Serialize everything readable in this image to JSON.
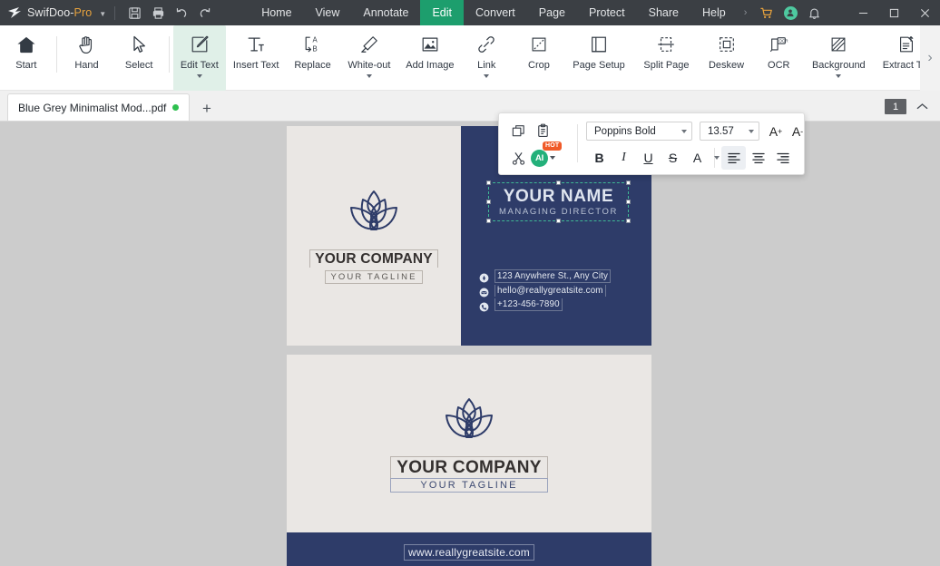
{
  "app": {
    "brand_name": "SwifDoo-",
    "brand_suffix": "Pro",
    "quick_actions": [
      {
        "name": "save-icon",
        "label": "Save"
      },
      {
        "name": "print-icon",
        "label": "Print"
      },
      {
        "name": "undo-icon",
        "label": "Undo"
      },
      {
        "name": "redo-icon",
        "label": "Redo"
      }
    ],
    "menu": [
      {
        "label": "Home",
        "active": false
      },
      {
        "label": "View",
        "active": false
      },
      {
        "label": "Annotate",
        "active": false
      },
      {
        "label": "Edit",
        "active": true
      },
      {
        "label": "Convert",
        "active": false
      },
      {
        "label": "Page",
        "active": false
      },
      {
        "label": "Protect",
        "active": false
      },
      {
        "label": "Share",
        "active": false
      },
      {
        "label": "Help",
        "active": false
      }
    ],
    "menu_overflow": "›",
    "right_icons": [
      {
        "name": "cart-icon",
        "label": "Shop"
      },
      {
        "name": "user-avatar-icon",
        "label": "Account"
      },
      {
        "name": "bell-icon",
        "label": "Notifications"
      }
    ],
    "window_controls": [
      {
        "name": "minimize-button",
        "label": "—"
      },
      {
        "name": "maximize-button",
        "label": "□"
      },
      {
        "name": "close-button",
        "label": "✕"
      }
    ]
  },
  "ribbon": {
    "items": [
      {
        "label": "Start",
        "icon": "home-icon",
        "dropdown": false,
        "active": false
      },
      {
        "label": "Hand",
        "icon": "hand-icon",
        "dropdown": false,
        "active": false
      },
      {
        "label": "Select",
        "icon": "cursor-icon",
        "dropdown": false,
        "active": false
      },
      {
        "label": "Edit Text",
        "icon": "edit-text-icon",
        "dropdown": true,
        "active": true
      },
      {
        "label": "Insert Text",
        "icon": "insert-text-icon",
        "dropdown": false,
        "active": false
      },
      {
        "label": "Replace",
        "icon": "replace-icon",
        "dropdown": false,
        "active": false
      },
      {
        "label": "White-out",
        "icon": "whiteout-icon",
        "dropdown": true,
        "active": false
      },
      {
        "label": "Add Image",
        "icon": "add-image-icon",
        "dropdown": false,
        "active": false
      },
      {
        "label": "Link",
        "icon": "link-icon",
        "dropdown": true,
        "active": false
      },
      {
        "label": "Crop",
        "icon": "crop-icon",
        "dropdown": false,
        "active": false
      },
      {
        "label": "Page Setup",
        "icon": "page-setup-icon",
        "dropdown": false,
        "active": false
      },
      {
        "label": "Split Page",
        "icon": "split-page-icon",
        "dropdown": false,
        "active": false
      },
      {
        "label": "Deskew",
        "icon": "deskew-icon",
        "dropdown": false,
        "active": false
      },
      {
        "label": "OCR",
        "icon": "ocr-icon",
        "dropdown": false,
        "active": false
      },
      {
        "label": "Background",
        "icon": "background-icon",
        "dropdown": true,
        "active": false
      },
      {
        "label": "Extract TO",
        "icon": "extract-icon",
        "dropdown": false,
        "active": false
      }
    ],
    "overflow_label": "›"
  },
  "tabstrip": {
    "document_tab": "Blue Grey Minimalist Mod...pdf",
    "unsaved": true,
    "new_tab_label": "+",
    "page_number": "1",
    "collapse_label": "⌃"
  },
  "text_toolbar": {
    "copy_label": "Copy",
    "paste_label": "Paste",
    "cut_label": "Cut",
    "ai_label": "AI",
    "ai_badge": "HOT",
    "font_family": "Poppins Bold",
    "font_size": "13.57",
    "increase_size": "A",
    "increase_sup": "+",
    "decrease_size": "A",
    "decrease_sup": "-",
    "bold": "B",
    "italic": "I",
    "underline": "U",
    "strikethrough": "S",
    "font_color": "A",
    "align_left": "align-left",
    "align_center": "align-center",
    "align_right": "align-right",
    "active_alignment": "align-left"
  },
  "document": {
    "card_front": {
      "company_name": "YOUR COMPANY",
      "tagline": "YOUR TAGLINE",
      "person_name": "YOUR NAME",
      "person_role": "MANAGING DIRECTOR",
      "contact": [
        {
          "icon": "location-pin-icon",
          "text": "123 Anywhere St., Any City"
        },
        {
          "icon": "envelope-icon",
          "text": "hello@reallygreatsite.com"
        },
        {
          "icon": "phone-icon",
          "text": "+123-456-7890"
        }
      ]
    },
    "card_back": {
      "company_name": "YOUR COMPANY",
      "tagline": "YOUR TAGLINE",
      "website": "www.reallygreatsite.com"
    }
  },
  "colors": {
    "titlebar": "#3b3f44",
    "accent_green": "#1d9e6d",
    "brand_orange": "#e8a33d",
    "card_navy": "#2e3c69",
    "card_beige": "#eae7e4",
    "workspace": "#cccccc",
    "selection_teal": "#3fb894",
    "hot_badge": "#f05a28"
  }
}
